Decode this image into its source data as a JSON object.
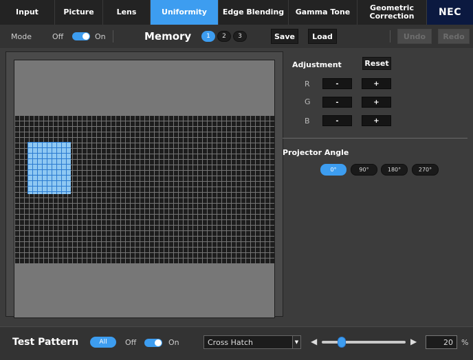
{
  "tabs": [
    {
      "label": "Input",
      "active": false
    },
    {
      "label": "Picture",
      "active": false
    },
    {
      "label": "Lens",
      "active": false
    },
    {
      "label": "Uniformity",
      "active": true
    },
    {
      "label": "Edge Blending",
      "active": false
    },
    {
      "label": "Gamma Tone",
      "active": false
    },
    {
      "label": "Geometric Correction",
      "active": false
    }
  ],
  "brand": "NEC",
  "toolbar": {
    "mode_label": "Mode",
    "off_label": "Off",
    "on_label": "On",
    "mode_on": true,
    "memory_label": "Memory",
    "memory_slots": [
      "1",
      "2",
      "3"
    ],
    "memory_selected": "1",
    "save_label": "Save",
    "load_label": "Load",
    "undo_label": "Undo",
    "redo_label": "Redo"
  },
  "adjustment": {
    "title": "Adjustment",
    "reset_label": "Reset",
    "channels": [
      {
        "label": "R",
        "minus": "-",
        "plus": "+"
      },
      {
        "label": "G",
        "minus": "-",
        "plus": "+"
      },
      {
        "label": "B",
        "minus": "-",
        "plus": "+"
      }
    ]
  },
  "projector_angle": {
    "title": "Projector Angle",
    "options": [
      "0°",
      "90°",
      "180°",
      "270°"
    ],
    "selected": "0°"
  },
  "test_pattern": {
    "title": "Test Pattern",
    "all_label": "All",
    "off_label": "Off",
    "on_label": "On",
    "enabled": true,
    "pattern": "Cross Hatch",
    "value": "20",
    "unit": "%"
  },
  "colors": {
    "accent": "#3d9df0",
    "brand_bg": "#0b1940",
    "grid_highlight": "#8fc8f2"
  }
}
